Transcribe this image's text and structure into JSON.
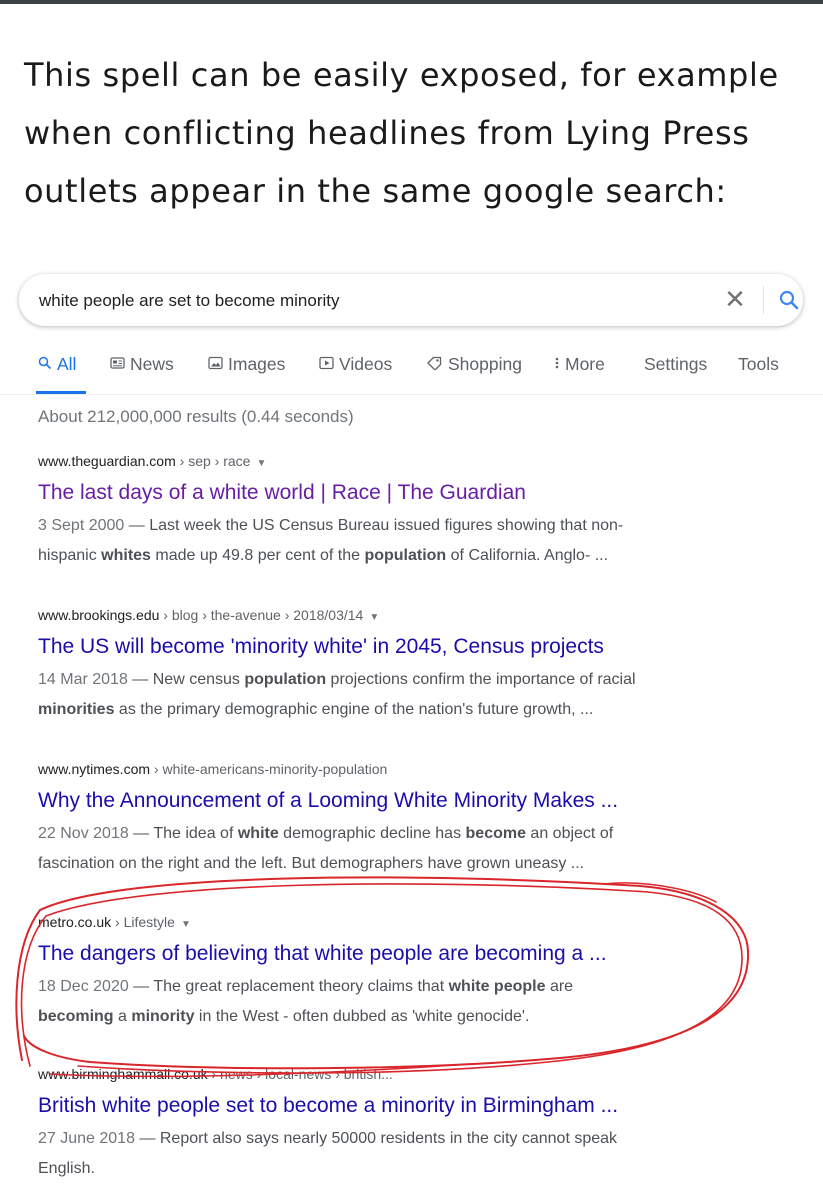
{
  "intro": {
    "lines": [
      "This spell can be easily exposed, for example",
      "when conflicting headlines from Lying Press",
      "outlets appear in the same google search:"
    ]
  },
  "search": {
    "query": "white people are set to become minority",
    "clear_glyph": "✕"
  },
  "tabs": [
    {
      "label": "All",
      "icon": "search-icon"
    },
    {
      "label": "News",
      "icon": "news-icon"
    },
    {
      "label": "Images",
      "icon": "image-icon"
    },
    {
      "label": "Videos",
      "icon": "video-icon"
    },
    {
      "label": "Shopping",
      "icon": "tag-icon"
    },
    {
      "label": "More",
      "icon": "more-vert-icon"
    },
    {
      "label": "Settings"
    },
    {
      "label": "Tools"
    }
  ],
  "stats": "About 212,000,000 results (0.44 seconds)",
  "results": [
    {
      "domain": "www.theguardian.com",
      "crumbs": " › sep › race",
      "title": "The last days of a white world | Race | The Guardian",
      "date": "3 Sept 2000",
      "line1_rest": " — Last week the US Census Bureau issued figures showing that non-",
      "line2": [
        {
          "t": "hispanic "
        },
        {
          "b": "whites"
        },
        {
          "t": " made up 49.8 per cent of the "
        },
        {
          "b": "population"
        },
        {
          "t": " of California. Anglo- ..."
        }
      ]
    },
    {
      "domain": "www.brookings.edu",
      "crumbs": " › blog › the-avenue › 2018/03/14",
      "title": "The US will become 'minority white' in 2045, Census projects",
      "date": "14 Mar 2018",
      "line1": [
        {
          "t": " — New census "
        },
        {
          "b": "population"
        },
        {
          "t": " projections confirm the importance of racial"
        }
      ],
      "line2": [
        {
          "b": "minorities"
        },
        {
          "t": " as the primary demographic engine of the nation's future growth, ..."
        }
      ]
    },
    {
      "domain": "www.nytimes.com",
      "crumbs": " › white-americans-minority-population",
      "title": "Why the Announcement of a Looming White Minority Makes ...",
      "date": "22 Nov 2018",
      "line1": [
        {
          "t": " — The idea of "
        },
        {
          "b": "white"
        },
        {
          "t": " demographic decline has "
        },
        {
          "b": "become"
        },
        {
          "t": " an object of"
        }
      ],
      "line2": [
        {
          "t": "fascination on the right and the left. But demographers have grown uneasy ..."
        }
      ]
    },
    {
      "domain": "metro.co.uk",
      "crumbs": " › Lifestyle",
      "title": "The dangers of believing that white people are becoming a ...",
      "date": "18 Dec 2020",
      "line1": [
        {
          "t": " — The great replacement theory claims that "
        },
        {
          "b": "white people"
        },
        {
          "t": " are"
        }
      ],
      "line2": [
        {
          "b": "becoming"
        },
        {
          "t": " a "
        },
        {
          "b": "minority"
        },
        {
          "t": " in the West - often dubbed as 'white genocide'."
        }
      ]
    },
    {
      "domain": "www.birminghammail.co.uk",
      "crumbs": " › news › local-news › british...",
      "title": "British white people set to become a minority in Birmingham ...",
      "date": "27 June 2018",
      "line1": [
        {
          "t": " — Report also says nearly 50000 residents in the city cannot speak"
        }
      ],
      "line2": [
        {
          "t": "English."
        }
      ]
    }
  ],
  "colors": {
    "link": "#1a0dab",
    "visited_link": "#681da8",
    "active_tab": "#1a73e8",
    "annotation": "#d9262b"
  }
}
